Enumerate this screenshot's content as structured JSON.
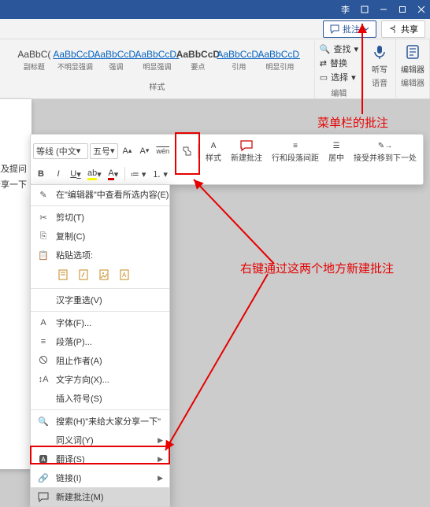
{
  "titlebar": {
    "user_prefix": "李"
  },
  "header": {
    "comment_btn": "批注",
    "share_btn": "共享"
  },
  "ribbon": {
    "styles_label": "样式",
    "styles": [
      {
        "preview": "AaBbC(",
        "name": "副标题"
      },
      {
        "preview": "AaBbCcD.",
        "name": "不明显强调",
        "style": "underline"
      },
      {
        "preview": "AaBbCcD.",
        "name": "强调",
        "style": "underline"
      },
      {
        "preview": "AaBbCcD.",
        "name": "明显强调",
        "style": "underline"
      },
      {
        "preview": "AaBbCcD",
        "name": "要点",
        "style": "emph"
      },
      {
        "preview": "AaBbCcD.",
        "name": "引用",
        "style": "underline"
      },
      {
        "preview": "AaBbCcD.",
        "name": "明显引用",
        "style": "underline"
      }
    ],
    "editing": {
      "label": "编辑",
      "find": "查找",
      "replace": "替换",
      "select": "选择"
    },
    "voice": {
      "label": "语音",
      "dictate": "听写"
    },
    "editor": {
      "label": "编辑器",
      "btn": "编辑器"
    }
  },
  "page": {
    "line1": "以及提问",
    "line2": "给大家分享一下"
  },
  "mini": {
    "font": "等线 (中文",
    "size": "五号",
    "styles_btn": "样式",
    "new_comment": "新建批注",
    "line_spacing": "行和段落间距",
    "align": "居中",
    "track_next": "接受并移到下一处",
    "bold": "B",
    "italic": "I",
    "underline": "U"
  },
  "context": {
    "search_editor": "在\"编辑器\"中查看所选内容(E)",
    "cut": "剪切(T)",
    "copy": "复制(C)",
    "paste_options": "粘贴选项:",
    "hanzi": "汉字重选(V)",
    "font": "字体(F)...",
    "paragraph": "段落(P)...",
    "block_a11y": "阻止作者(A)",
    "text_dir": "文字方向(X)...",
    "insert_symbol": "插入符号(S)",
    "search_sel": "搜索(H)\"来给大家分享一下\"",
    "synonyms": "同义词(Y)",
    "translate": "翻译(S)",
    "link": "链接(I)",
    "new_comment": "新建批注(M)"
  },
  "annotations": {
    "top": "菜单栏的批注",
    "right": "右键通过这两个地方新建批注"
  }
}
